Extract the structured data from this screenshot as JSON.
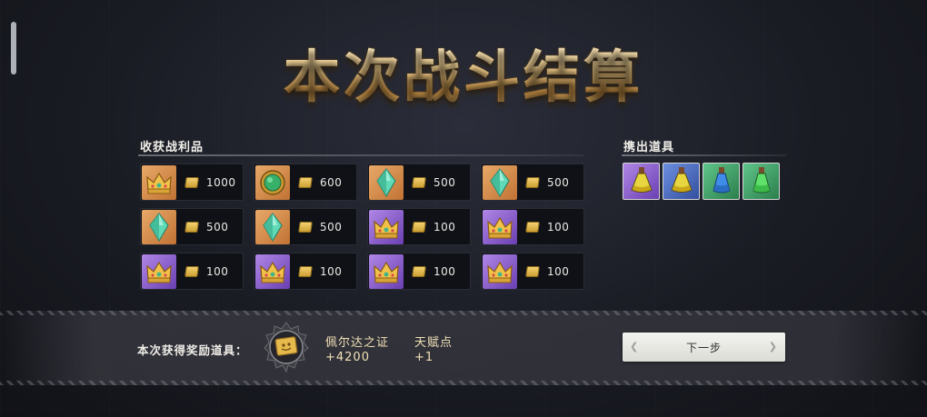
{
  "title": "本次战斗结算",
  "loot_section": {
    "label": "收获战利品",
    "items": [
      {
        "icon": "crown-icon",
        "rarity": "orange",
        "amount": "1000"
      },
      {
        "icon": "emerald-icon",
        "rarity": "orange",
        "amount": "600"
      },
      {
        "icon": "crystal-icon",
        "rarity": "orange",
        "amount": "500"
      },
      {
        "icon": "crystal-icon",
        "rarity": "orange",
        "amount": "500"
      },
      {
        "icon": "crystal-icon",
        "rarity": "orange",
        "amount": "500"
      },
      {
        "icon": "crystal-icon",
        "rarity": "orange",
        "amount": "500"
      },
      {
        "icon": "crown-icon",
        "rarity": "purple",
        "amount": "100"
      },
      {
        "icon": "crown-icon",
        "rarity": "purple",
        "amount": "100"
      },
      {
        "icon": "crown-icon",
        "rarity": "purple",
        "amount": "100"
      },
      {
        "icon": "crown-icon",
        "rarity": "purple",
        "amount": "100"
      },
      {
        "icon": "crown-icon",
        "rarity": "purple",
        "amount": "100"
      },
      {
        "icon": "crown-icon",
        "rarity": "purple",
        "amount": "100"
      }
    ]
  },
  "taken_section": {
    "label": "携出道具",
    "items": [
      {
        "icon": "yellow-potion-icon",
        "rarity": "purple"
      },
      {
        "icon": "yellow-potion-icon",
        "rarity": "blue"
      },
      {
        "icon": "blue-potion-icon",
        "rarity": "green"
      },
      {
        "icon": "green-potion-icon",
        "rarity": "green"
      }
    ]
  },
  "reward": {
    "label": "本次获得奖励道具：",
    "token_name": "佩尔达之证",
    "token_value": "+4200",
    "talent_name": "天赋点",
    "talent_value": "+1"
  },
  "next_button": "下一步",
  "colors": {
    "orange": "#d48a4a",
    "purple": "#8a5ccc",
    "green": "#43a56a",
    "blue": "#4f6cc0",
    "gold_text": "#f1e0b5"
  }
}
